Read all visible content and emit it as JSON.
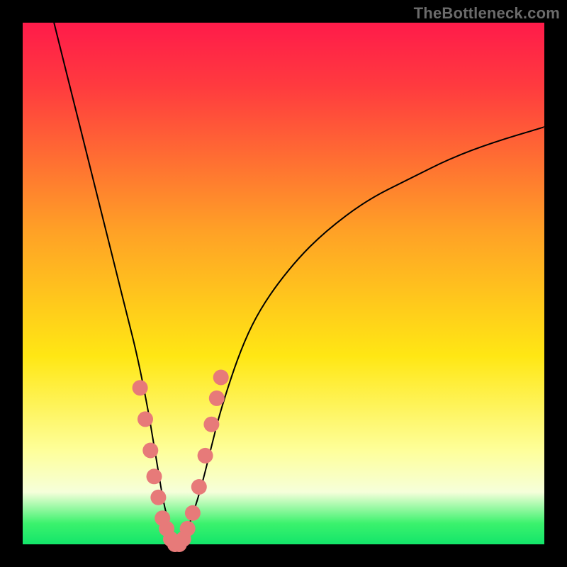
{
  "watermark": "TheBottleneck.com",
  "colors": {
    "top": "#ff1b4a",
    "red2": "#ff3a3f",
    "orange": "#ffa126",
    "yellow": "#ffe714",
    "pale": "#feff9a",
    "pale2": "#f6ffda",
    "green": "#3bf26d",
    "green2": "#13e56a",
    "dot": "#e77a79",
    "curve": "#000000"
  },
  "chart_data": {
    "type": "line",
    "title": "",
    "xlabel": "",
    "ylabel": "",
    "xlim": [
      0,
      100
    ],
    "ylim": [
      0,
      100
    ],
    "grid": false,
    "legend": false,
    "series": [
      {
        "name": "bottleneck-curve",
        "x": [
          6,
          8,
          10,
          12,
          14,
          16,
          18,
          20,
          22,
          24,
          25,
          26,
          27,
          28,
          29,
          30,
          31,
          32,
          34,
          36,
          38,
          42,
          46,
          52,
          58,
          66,
          74,
          82,
          90,
          100
        ],
        "y": [
          100,
          92,
          84,
          76,
          68,
          60,
          52,
          44,
          36,
          26,
          20,
          14,
          8,
          4,
          1,
          0,
          1,
          4,
          10,
          18,
          26,
          38,
          46,
          54,
          60,
          66,
          70,
          74,
          77,
          80
        ]
      }
    ],
    "highlight_points": {
      "name": "pink-dots",
      "comment": "points near the valley where the curve is marked",
      "x": [
        22.5,
        23.5,
        24.5,
        25.2,
        26.0,
        26.8,
        27.6,
        28.4,
        29.2,
        30.0,
        30.8,
        31.6,
        32.6,
        33.8,
        35.0,
        36.2,
        37.2,
        38.0
      ],
      "y": [
        30,
        24,
        18,
        13,
        9,
        5,
        3,
        1,
        0,
        0,
        1,
        3,
        6,
        11,
        17,
        23,
        28,
        32
      ]
    }
  }
}
